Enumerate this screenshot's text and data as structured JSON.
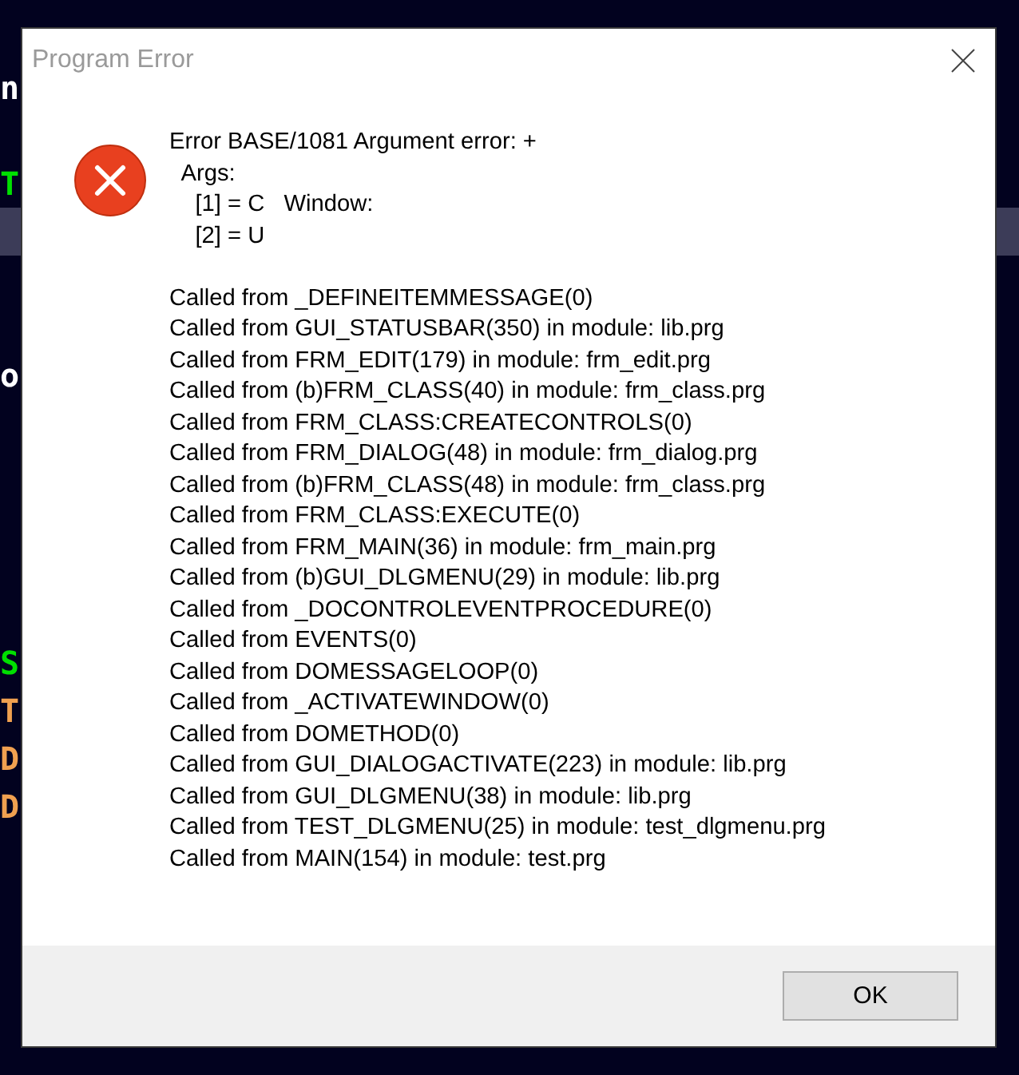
{
  "background_rows": [
    {
      "text": "n",
      "color": "#ffffff",
      "highlighted": false
    },
    {
      "highlighted": false
    },
    {
      "text": "T",
      "color": "#00e000",
      "highlighted": false
    },
    {
      "highlighted": true
    },
    {
      "highlighted": false
    },
    {
      "highlighted": false
    },
    {
      "text": "o",
      "color": "#ffffff",
      "highlighted": false
    },
    {
      "highlighted": false
    },
    {
      "highlighted": false
    },
    {
      "highlighted": false
    },
    {
      "highlighted": false
    },
    {
      "highlighted": false
    },
    {
      "text": "S",
      "color": "#00e000",
      "highlighted": false
    },
    {
      "text": "T",
      "color": "#f0a050",
      "highlighted": false
    },
    {
      "text": "D",
      "color": "#f0a050",
      "highlighted": false
    },
    {
      "text": "D",
      "color": "#f0a050",
      "highlighted": false
    }
  ],
  "dialog": {
    "title": "Program Error",
    "message_lines": [
      "Error BASE/1081 Argument error: +",
      "  Args:",
      "    [1] = C   Window:",
      "    [2] = U"
    ],
    "call_stack": [
      "Called from _DEFINEITEMMESSAGE(0)",
      "Called from GUI_STATUSBAR(350) in module: lib.prg",
      "Called from FRM_EDIT(179) in module: frm_edit.prg",
      "Called from (b)FRM_CLASS(40) in module: frm_class.prg",
      "Called from FRM_CLASS:CREATECONTROLS(0)",
      "Called from FRM_DIALOG(48) in module: frm_dialog.prg",
      "Called from (b)FRM_CLASS(48) in module: frm_class.prg",
      "Called from FRM_CLASS:EXECUTE(0)",
      "Called from FRM_MAIN(36) in module: frm_main.prg",
      "Called from (b)GUI_DLGMENU(29) in module: lib.prg",
      "Called from _DOCONTROLEVENTPROCEDURE(0)",
      "Called from EVENTS(0)",
      "Called from DOMESSAGELOOP(0)",
      "Called from _ACTIVATEWINDOW(0)",
      "Called from DOMETHOD(0)",
      "Called from GUI_DIALOGACTIVATE(223) in module: lib.prg",
      "Called from GUI_DLGMENU(38) in module: lib.prg",
      "Called from TEST_DLGMENU(25) in module: test_dlgmenu.prg",
      "Called from MAIN(154) in module: test.prg"
    ],
    "buttons": [
      "OK"
    ]
  }
}
